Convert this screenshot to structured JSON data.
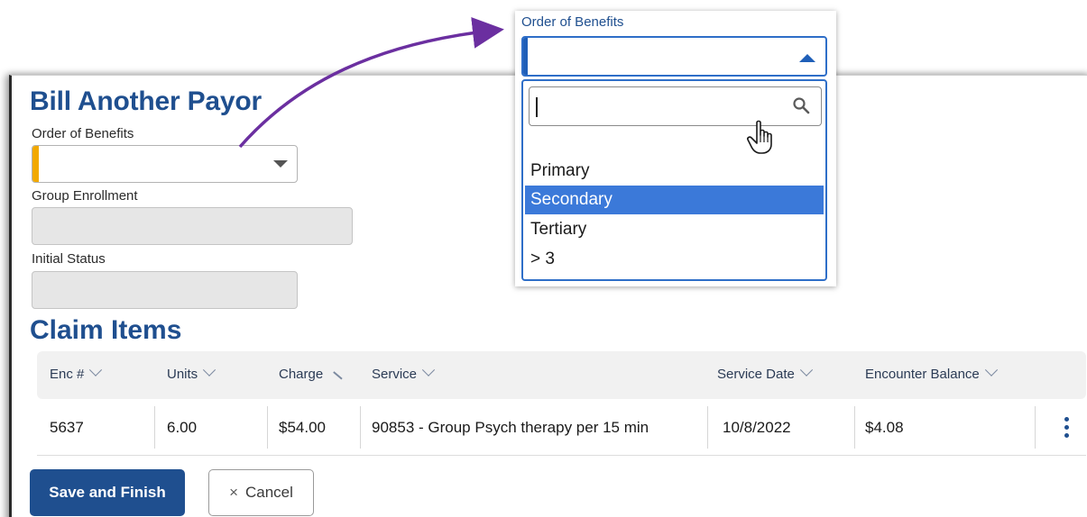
{
  "form": {
    "title": "Bill Another Payor",
    "order_of_benefits_label": "Order of Benefits",
    "order_of_benefits_value": "",
    "group_enrollment_label": "Group Enrollment",
    "group_enrollment_value": "",
    "initial_status_label": "Initial Status",
    "initial_status_value": ""
  },
  "claim_items": {
    "title": "Claim Items",
    "columns": [
      "Enc #",
      "Units",
      "Charge",
      "Service",
      "Service Date",
      "Encounter Balance"
    ],
    "rows": [
      {
        "enc": "5637",
        "units": "6.00",
        "charge": "$54.00",
        "service": "90853 - Group Psych therapy per 15 min",
        "service_date": "10/8/2022",
        "encounter_balance": "$4.08"
      }
    ]
  },
  "actions": {
    "save_label": "Save and Finish",
    "cancel_label": "Cancel",
    "cancel_icon": "×"
  },
  "callout": {
    "label": "Order of Benefits",
    "search_value": "",
    "options": [
      "Primary",
      "Secondary",
      "Tertiary",
      "> 3"
    ],
    "highlighted": "Secondary"
  },
  "colors": {
    "brand_blue": "#1f4f8f",
    "highlight_blue": "#3b79d9",
    "required_marker": "#f2a900",
    "arrow_purple": "#6b2fa0"
  }
}
